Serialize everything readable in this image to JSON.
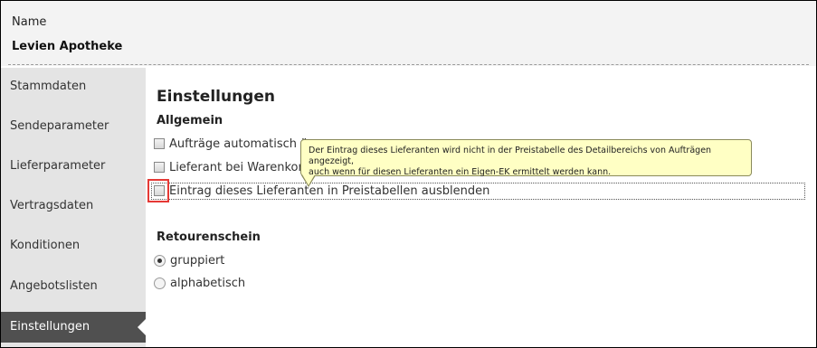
{
  "header": {
    "field_label": "Name",
    "value": "Levien Apotheke"
  },
  "sidebar": {
    "items": [
      {
        "label": "Stammdaten"
      },
      {
        "label": "Sendeparameter"
      },
      {
        "label": "Lieferparameter"
      },
      {
        "label": "Vertragsdaten"
      },
      {
        "label": "Konditionen"
      },
      {
        "label": "Angebotslisten"
      },
      {
        "label": "Einstellungen",
        "active": true
      }
    ]
  },
  "main": {
    "title": "Einstellungen",
    "allgemein": {
      "heading": "Allgemein",
      "options": [
        {
          "label": "Aufträge automatisch ü",
          "checked": false
        },
        {
          "label": "Lieferant bei Warenkor",
          "checked": false
        },
        {
          "label": "Eintrag dieses Lieferanten in Preistabellen ausblenden",
          "checked": false,
          "focused": true
        }
      ]
    },
    "retourenschein": {
      "heading": "Retourenschein",
      "options": [
        {
          "label": "gruppiert",
          "selected": true
        },
        {
          "label": "alphabetisch",
          "selected": false
        }
      ]
    }
  },
  "tooltip": {
    "line1": "Der Eintrag dieses Lieferanten wird nicht in der Preistabelle des Detailbereichs von Aufträgen angezeigt,",
    "line2": "auch wenn für diesen Lieferanten ein Eigen-EK ermittelt werden kann."
  },
  "colors": {
    "highlight": "#e53935",
    "tooltip_bg": "#ffffc4",
    "sidebar_active": "#505050"
  }
}
